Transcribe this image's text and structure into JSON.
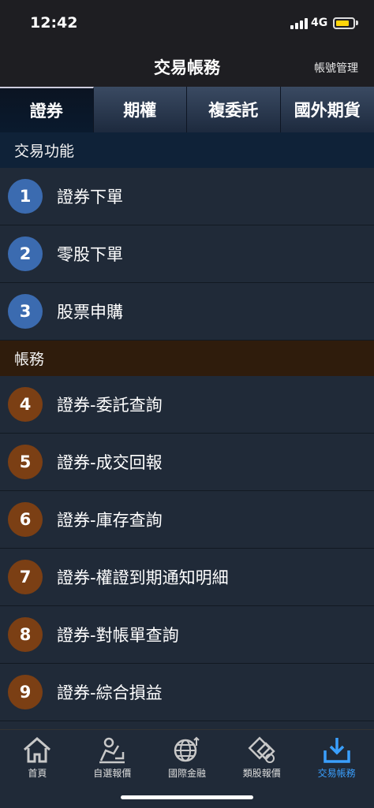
{
  "status": {
    "time": "12:42",
    "network": "4G"
  },
  "nav": {
    "title": "交易帳務",
    "action": "帳號管理"
  },
  "tabs": [
    {
      "label": "證券",
      "active": true
    },
    {
      "label": "期權",
      "active": false
    },
    {
      "label": "複委託",
      "active": false
    },
    {
      "label": "國外期貨",
      "active": false
    }
  ],
  "sections": [
    {
      "title": "交易功能",
      "color": "#0f2238",
      "items": [
        {
          "num": "1",
          "label": "證券下單"
        },
        {
          "num": "2",
          "label": "零股下單"
        },
        {
          "num": "3",
          "label": "股票申購"
        }
      ]
    },
    {
      "title": "帳務",
      "color": "#2f1c0c",
      "items": [
        {
          "num": "4",
          "label": "證券-委託查詢"
        },
        {
          "num": "5",
          "label": "證券-成交回報"
        },
        {
          "num": "6",
          "label": "證券-庫存查詢"
        },
        {
          "num": "7",
          "label": "證券-權證到期通知明細"
        },
        {
          "num": "8",
          "label": "證券-對帳單查詢"
        },
        {
          "num": "9",
          "label": "證券-綜合損益"
        }
      ]
    }
  ],
  "tabbar": [
    {
      "label": "首頁",
      "icon": "home-icon",
      "active": false
    },
    {
      "label": "自選報價",
      "icon": "person-chart-icon",
      "active": false
    },
    {
      "label": "國際金融",
      "icon": "globe-icon",
      "active": false
    },
    {
      "label": "類股報價",
      "icon": "category-icon",
      "active": false
    },
    {
      "label": "交易帳務",
      "icon": "tray-download-icon",
      "active": true
    }
  ],
  "colors": {
    "accent": "#3aa0ff",
    "badge_blue": "#3b6bb0",
    "badge_brown": "#7b3f14"
  }
}
